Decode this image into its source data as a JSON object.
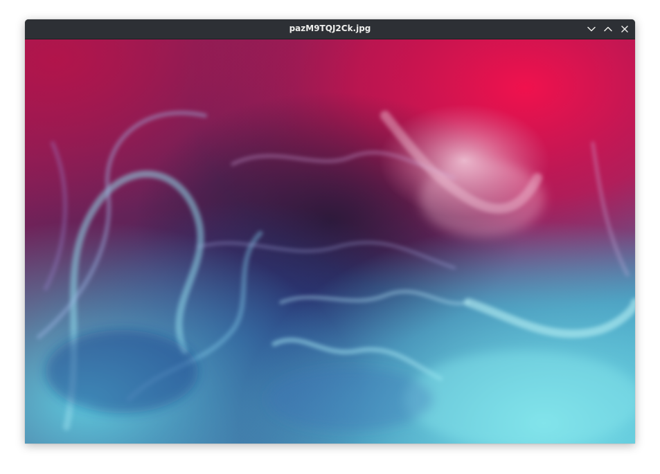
{
  "window": {
    "title": "pazM9TQJ2Ck.jpg",
    "titlebar_color": "#2d3035",
    "title_color": "#eeeeec"
  },
  "controls": {
    "minimize_icon": "chevron-down-icon",
    "maximize_icon": "chevron-up-icon",
    "close_icon": "close-icon"
  },
  "image": {
    "description_colors": {
      "magenta": "#e0104a",
      "deep_purple": "#3a1f4a",
      "navy": "#2a3f80",
      "cyan": "#5fd0e0",
      "pale_pink": "#e8b4cc"
    }
  }
}
